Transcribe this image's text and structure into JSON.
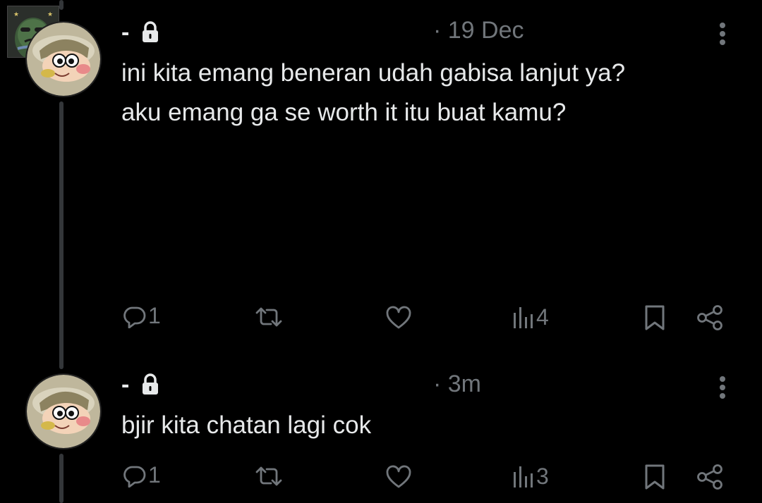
{
  "tweets": [
    {
      "author_name": "-",
      "timestamp": "· 19 Dec",
      "text": "ini kita emang beneran udah gabisa lanjut ya?\naku emang ga se worth it itu buat kamu?",
      "replies": "1",
      "views": "4"
    },
    {
      "author_name": "-",
      "timestamp": "· 3m",
      "text": "bjir kita chatan lagi cok",
      "replies": "1",
      "views": "3"
    }
  ],
  "icons": {
    "reply": "reply-icon",
    "retweet": "retweet-icon",
    "like": "heart-icon",
    "views": "views-icon",
    "bookmark": "bookmark-icon",
    "share": "share-icon",
    "lock": "lock-icon",
    "more": "more-vertical-icon"
  },
  "colors": {
    "background": "#000000",
    "text": "#e7e9ea",
    "muted": "#71767b",
    "thread_line": "#333639"
  }
}
